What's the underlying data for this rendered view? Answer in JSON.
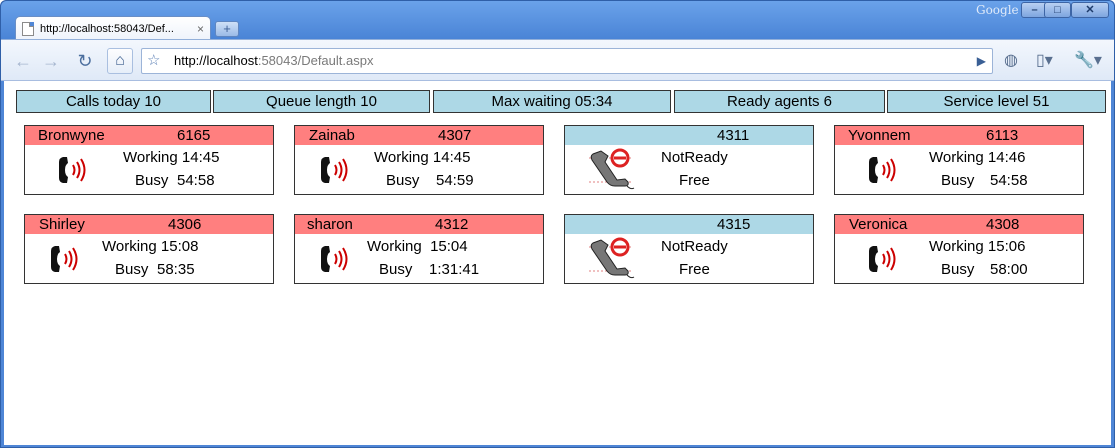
{
  "browser": {
    "tab_title": "http://localhost:58043/Def...",
    "brand": "Google",
    "url_host": "http://localhost",
    "url_rest": ":58043/Default.aspx"
  },
  "stats": [
    {
      "label": "Calls today 10"
    },
    {
      "label": "Queue length 10"
    },
    {
      "label": "Max waiting 05:34"
    },
    {
      "label": "Ready agents 6"
    },
    {
      "label": "Service level 51"
    }
  ],
  "agents": [
    {
      "name": "Bronwyne",
      "ext": "6165",
      "status": "Working 14:45",
      "sub_label": "Busy",
      "sub_value": "54:58",
      "state": "busy"
    },
    {
      "name": "Zainab",
      "ext": "4307",
      "status": "Working 14:45",
      "sub_label": "Busy",
      "sub_value": "54:59",
      "state": "busy"
    },
    {
      "name": "",
      "ext": "4311",
      "status": "NotReady",
      "sub_label": "Free",
      "sub_value": "",
      "state": "idle"
    },
    {
      "name": "Yvonnem",
      "ext": "6113",
      "status": "Working 14:46",
      "sub_label": "Busy",
      "sub_value": "54:58",
      "state": "busy"
    },
    {
      "name": "Shirley",
      "ext": "4306",
      "status": "Working 15:08",
      "sub_label": "Busy",
      "sub_value": "58:35",
      "state": "busy"
    },
    {
      "name": "sharon",
      "ext": "4312",
      "status": "Working  15:04",
      "sub_label": "Busy",
      "sub_value": "1:31:41",
      "state": "busy"
    },
    {
      "name": "",
      "ext": "4315",
      "status": "NotReady",
      "sub_label": "Free",
      "sub_value": "",
      "state": "idle"
    },
    {
      "name": "Veronica",
      "ext": "4308",
      "status": "Working 15:06",
      "sub_label": "Busy",
      "sub_value": "58:00",
      "state": "busy"
    }
  ],
  "colors": {
    "busy_header": "#ff7f7f",
    "idle_header": "#add8e6",
    "stat_background": "#add8e6"
  },
  "icons": {
    "busy": "ringing-phone-icon",
    "idle": "phone-blocked-icon"
  }
}
